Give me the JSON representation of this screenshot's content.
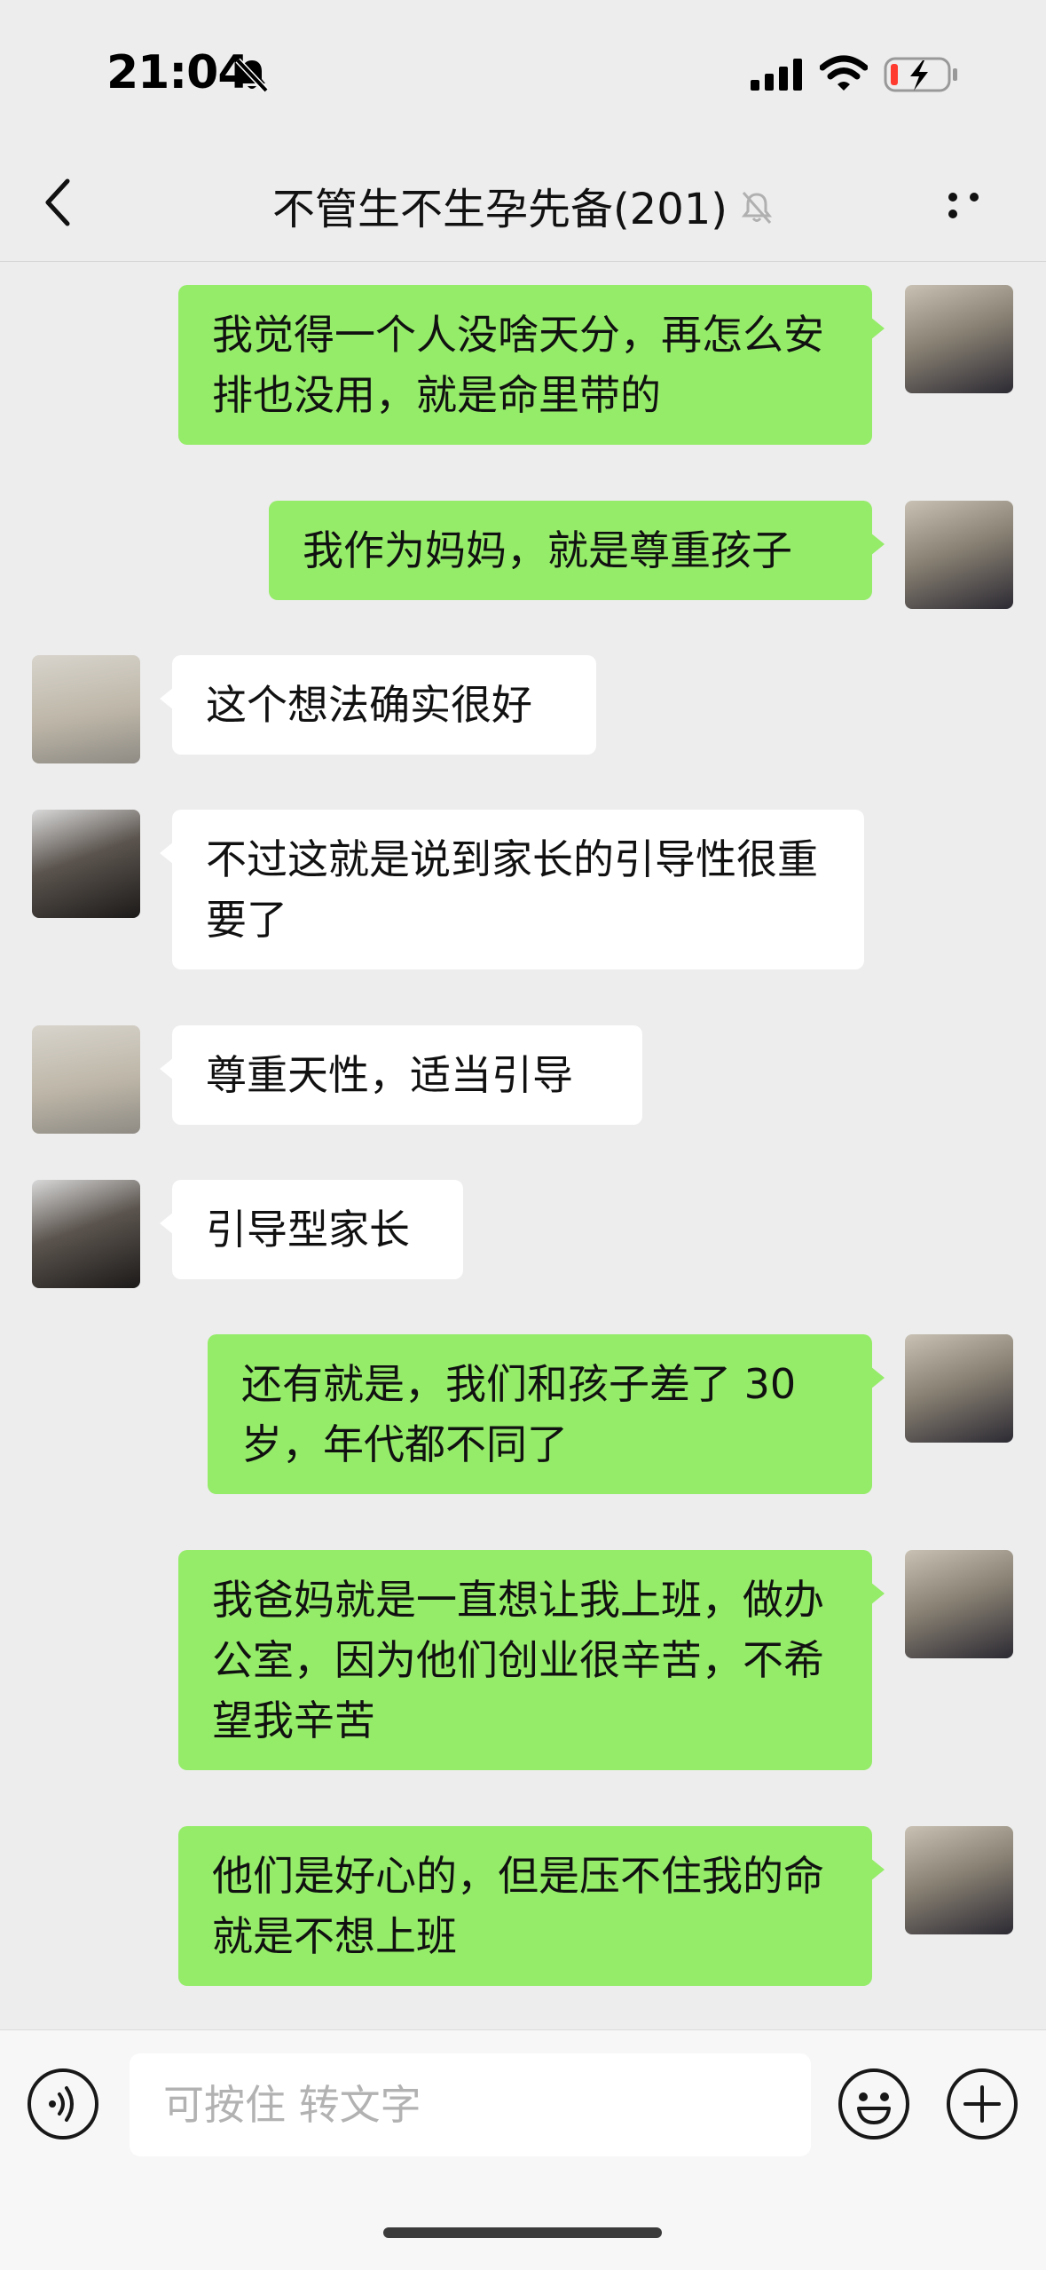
{
  "status_bar": {
    "time": "21:04"
  },
  "header": {
    "title": "不管生不生孕先备(201)"
  },
  "messages": [
    {
      "side": "out",
      "avatar": "me",
      "text": "我觉得一个人没啥天分，再怎么安排也没用，就是命里带的"
    },
    {
      "side": "out",
      "avatar": "me",
      "text": "我作为妈妈，就是尊重孩子"
    },
    {
      "side": "in",
      "avatar": "a",
      "text": "这个想法确实很好"
    },
    {
      "side": "in",
      "avatar": "b",
      "text": "不过这就是说到家长的引导性很重要了"
    },
    {
      "side": "in",
      "avatar": "a",
      "text": "尊重天性，适当引导"
    },
    {
      "side": "in",
      "avatar": "b",
      "text": "引导型家长"
    },
    {
      "side": "out",
      "avatar": "me",
      "text": "还有就是，我们和孩子差了 30 岁，年代都不同了"
    },
    {
      "side": "out",
      "avatar": "me",
      "text": "我爸妈就是一直想让我上班，做办公室，因为他们创业很辛苦，不希望我辛苦"
    },
    {
      "side": "out",
      "avatar": "me",
      "text": "他们是好心的，但是压不住我的命就是不想上班"
    }
  ],
  "input": {
    "placeholder": "可按住 转文字"
  },
  "colors": {
    "out_bubble": "#95ec69",
    "in_bubble": "#ffffff",
    "background": "#ededed",
    "battery_low": "#ff3b30"
  },
  "icons": [
    "bell-off-icon",
    "signal-icon",
    "wifi-icon",
    "battery-charging-icon",
    "back-chevron-icon",
    "mute-icon",
    "more-icon",
    "voice-icon",
    "emoji-icon",
    "plus-icon"
  ]
}
